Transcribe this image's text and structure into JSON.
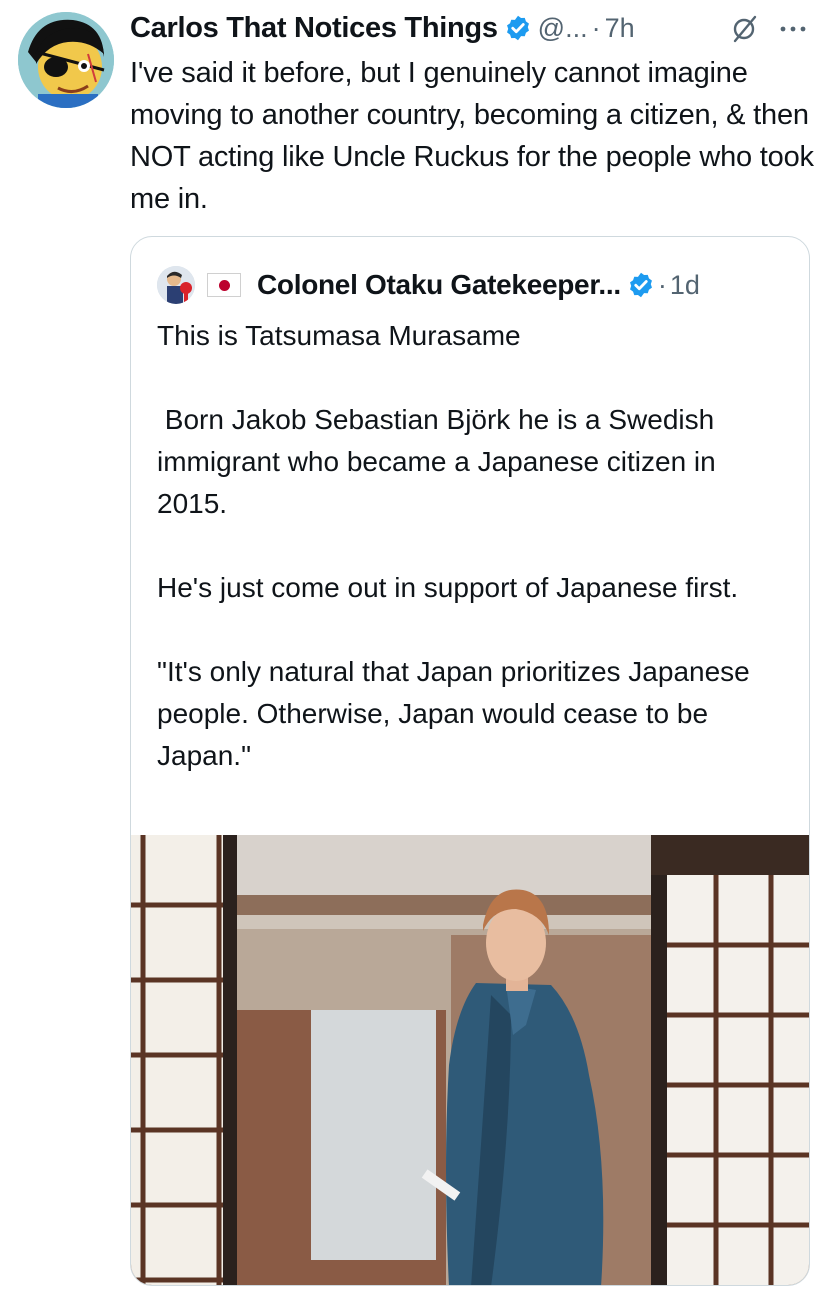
{
  "tweet": {
    "display_name": "Carlos That Notices Things",
    "handle": "@...",
    "separator": "·",
    "time": "7h",
    "text": "I've said it before, but I genuinely cannot imagine moving to another country, becoming a citizen, & then NOT acting like Uncle Ruckus for the people who took me in.",
    "icons": {
      "avatar": "cartoon-avatar-eyepatch",
      "verified": "verified-badge-icon",
      "grok": "grok-icon",
      "more": "more-options-icon"
    }
  },
  "quote": {
    "display_name": "Colonel Otaku Gatekeeper...",
    "separator": "·",
    "time": "1d",
    "text": "This is Tatsumasa Murasame\n\n Born Jakob Sebastian Björk he is a Swedish immigrant who became a Japanese citizen in 2015.\n\nHe's just come out in support of Japanese first.\n\n\"It's only natural that Japan prioritizes Japanese people. Otherwise, Japan would cease to be Japan.\"",
    "icons": {
      "avatar": "quote-avatar",
      "flag": "japan-flag-icon",
      "verified": "verified-badge-icon"
    },
    "media": "photo-man-in-kimono-shoji-room"
  },
  "colors": {
    "text": "#0f1419",
    "secondary": "#536471",
    "verified": "#1d9bf0",
    "border": "#cfd9de"
  }
}
